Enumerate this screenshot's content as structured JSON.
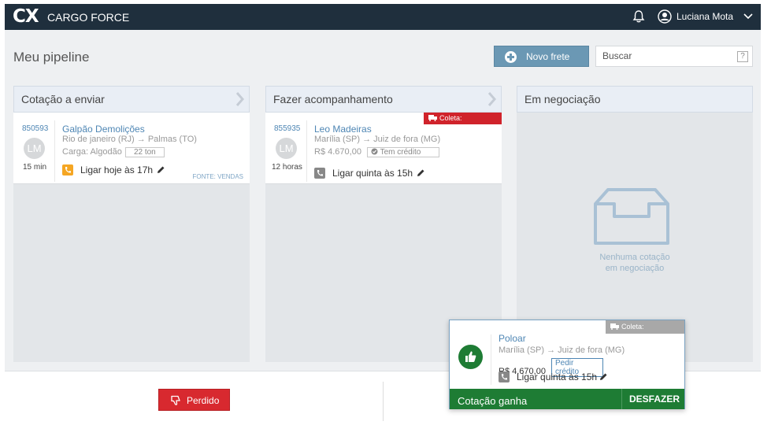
{
  "topbar": {
    "logo_mark": "CX",
    "logo_text": "CARGO FORCE",
    "user_name": "Luciana Mota"
  },
  "header": {
    "title": "Meu pipeline",
    "new_freight_label": "Novo frete",
    "search_placeholder": "Buscar",
    "search_help": "?"
  },
  "columns": [
    {
      "title": "Cotação a enviar",
      "card": {
        "id": "850593",
        "initials": "LM",
        "time": "15 min",
        "name": "Galpão Demolições",
        "route": "Rio de janeiro (RJ) → Palmas (TO)",
        "cargo_label": "Carga: Algodão",
        "cargo_weight": "22 ton",
        "call": "Ligar hoje às 17h",
        "source": "FONTE: VENDAS",
        "phone_color": "#f5a623"
      }
    },
    {
      "title": "Fazer acompanhamento",
      "card": {
        "id": "855935",
        "initials": "LM",
        "time": "12 horas",
        "name": "Leo Madeiras",
        "route": "Marília (SP) → Juiz de fora (MG)",
        "price": "R$ 4.670,00",
        "credit": "Tem crédito",
        "call": "Ligar quinta às 15h",
        "coleta": "Coleta:",
        "phone_color": "#888888"
      }
    },
    {
      "title": "Em negociação",
      "empty_line1": "Nenhuma cotação",
      "empty_line2": "em negociação"
    }
  ],
  "bottom": {
    "lost_label": "Perdido"
  },
  "drag_card": {
    "coleta": "Coleta:",
    "name": "Poloar",
    "route": "Marília (SP) → Juiz de fora (MG)",
    "price": "R$ 4.670,00",
    "credit_action": "Pedir crédito",
    "call": "Ligar quinta às 15h",
    "won_label": "Cotação ganha",
    "undo_label": "DESFAZER"
  },
  "colors": {
    "topbar": "#1f2f3d",
    "accent_blue": "#6b98b4",
    "link_blue": "#4e86b4",
    "danger_red": "#d8292f",
    "success_green": "#1e7c34"
  },
  "icons": [
    "bell-icon",
    "user-icon",
    "chevron-down-icon",
    "plus-icon",
    "help-icon",
    "chevron-right-icon",
    "phone-icon",
    "pencil-icon",
    "truck-icon",
    "check-circle-icon",
    "empty-box-icon",
    "thumbs-down-icon",
    "thumbs-up-icon"
  ]
}
